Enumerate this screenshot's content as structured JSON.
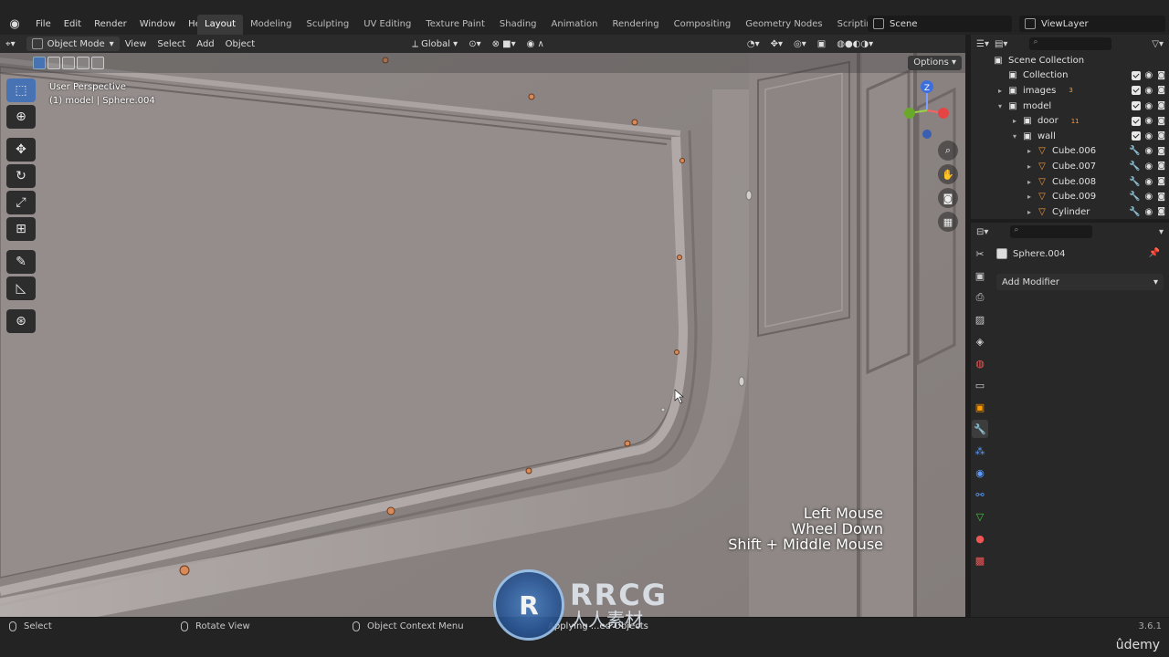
{
  "menu": {
    "logo": "blender-logo",
    "items": [
      "File",
      "Edit",
      "Render",
      "Window",
      "Help"
    ]
  },
  "workspaces": {
    "tabs": [
      "Layout",
      "Modeling",
      "Sculpting",
      "UV Editing",
      "Texture Paint",
      "Shading",
      "Animation",
      "Rendering",
      "Compositing",
      "Geometry Nodes",
      "Scripting"
    ],
    "active": "Layout",
    "add": "+"
  },
  "scene": {
    "label": "Scene"
  },
  "view_layer": {
    "label": "ViewLayer"
  },
  "viewport_header": {
    "mode": "Object Mode",
    "menus": [
      "View",
      "Select",
      "Add",
      "Object"
    ],
    "transform_orientation": "Global",
    "options": "Options"
  },
  "viewport": {
    "perspective": "User Perspective",
    "object": "(1) model | Sphere.004",
    "key_hints": [
      "Left Mouse",
      "Wheel Down",
      "Shift + Middle Mouse"
    ],
    "gizmo_z": "Z"
  },
  "toolbar": {
    "tools": [
      "select-box-icon",
      "cursor-icon",
      "move-icon",
      "rotate-icon",
      "scale-icon",
      "transform-icon",
      "annotate-icon",
      "measure-icon",
      "add-cube-icon"
    ]
  },
  "outliner": {
    "search_placeholder": "",
    "rows": [
      {
        "name": "Scene Collection",
        "indent": 0,
        "arrow": "",
        "badge": ""
      },
      {
        "name": "Collection",
        "indent": 1,
        "arrow": "",
        "badge": ""
      },
      {
        "name": "images",
        "indent": 1,
        "arrow": "▸",
        "badge": "3"
      },
      {
        "name": "model",
        "indent": 1,
        "arrow": "▾",
        "badge": ""
      },
      {
        "name": "door",
        "indent": 2,
        "arrow": "▸",
        "badge": "11"
      },
      {
        "name": "wall",
        "indent": 2,
        "arrow": "▾",
        "badge": ""
      },
      {
        "name": "Cube.006",
        "indent": 3,
        "arrow": "▸",
        "badge": ""
      },
      {
        "name": "Cube.007",
        "indent": 3,
        "arrow": "▸",
        "badge": ""
      },
      {
        "name": "Cube.008",
        "indent": 3,
        "arrow": "▸",
        "badge": ""
      },
      {
        "name": "Cube.009",
        "indent": 3,
        "arrow": "▸",
        "badge": ""
      },
      {
        "name": "Cylinder",
        "indent": 3,
        "arrow": "▸",
        "badge": ""
      }
    ]
  },
  "properties": {
    "object_name": "Sphere.004",
    "add_modifier": "Add Modifier"
  },
  "status": {
    "select": "Select",
    "rotate": "Rotate View",
    "context": "Object Context Menu",
    "message": "Applying ...ed Objects",
    "version": "3.6.1"
  },
  "watermark": {
    "big": "RRCG",
    "small": "人人素材"
  },
  "brand": "ûdemy"
}
